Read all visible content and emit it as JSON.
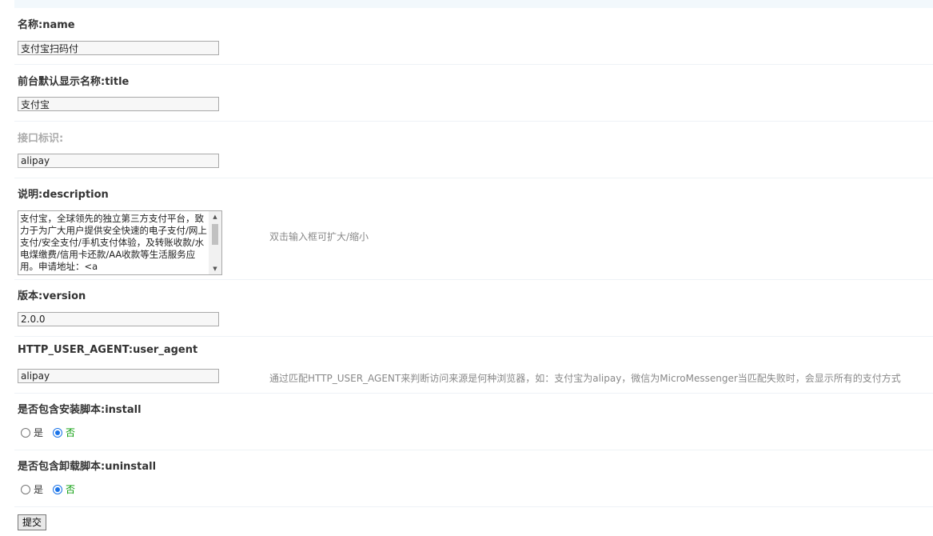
{
  "form": {
    "name": {
      "label": "名称:name",
      "value": "支付宝扫码付"
    },
    "title": {
      "label": "前台默认显示名称:title",
      "value": "支付宝"
    },
    "code": {
      "label": "接口标识:",
      "value": "alipay"
    },
    "description": {
      "label": "说明:description",
      "value": "支付宝，全球领先的独立第三方支付平台，致力于为广大用户提供安全快速的电子支付/网上支付/安全支付/手机支付体验，及转账收款/水电煤缴费/信用卡还款/AA收款等生活服务应用。申请地址：<a",
      "hint": "双击输入框可扩大/缩小"
    },
    "version": {
      "label": "版本:version",
      "value": "2.0.0"
    },
    "user_agent": {
      "label": "HTTP_USER_AGENT:user_agent",
      "value": "alipay",
      "hint": "通过匹配HTTP_USER_AGENT来判断访问来源是何种浏览器，如：支付宝为alipay，微信为MicroMessenger当匹配失败时，会显示所有的支付方式"
    },
    "install": {
      "label": "是否包含安装脚本:install",
      "yes": "是",
      "no": "否",
      "selected": "no"
    },
    "uninstall": {
      "label": "是否包含卸载脚本:uninstall",
      "yes": "是",
      "no": "否",
      "selected": "no"
    },
    "submit_label": "提交"
  },
  "colors": {
    "accent": "#1a73e8",
    "selected_text": "#009900",
    "hint": "#888888"
  }
}
